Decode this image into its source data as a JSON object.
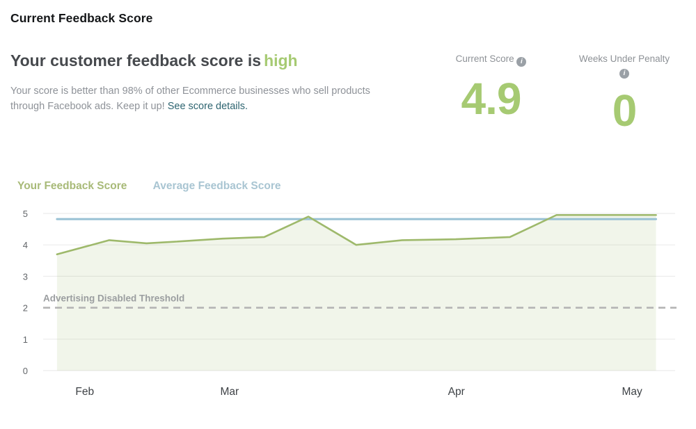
{
  "page": {
    "title": "Current Feedback Score"
  },
  "summary": {
    "heading_prefix": "Your customer feedback score is",
    "heading_status": "high",
    "body": "Your score is better than 98% of other Ecommerce businesses who sell products through Facebook ads. Keep it up!",
    "link_label": "See score details."
  },
  "stats": [
    {
      "label": "Current Score",
      "value": "4.9",
      "info_icon": "info-icon"
    },
    {
      "label": "Weeks Under Penalty",
      "value": "0",
      "info_icon": "info-icon"
    }
  ],
  "colors": {
    "accent_green": "#a6ca72",
    "line_green": "#9eb96b",
    "area_fill": "rgba(158,185,107,0.14)",
    "avg_blue": "#98c1d4",
    "legend_green": "#a8ba78",
    "legend_blue": "#a9c5d2",
    "link_teal": "#2d6470",
    "threshold_gray": "#b4b4b4",
    "grid_gray": "#ececec"
  },
  "chart_data": {
    "type": "line",
    "title": "",
    "xlabel": "",
    "ylabel": "",
    "ylim": [
      0,
      5
    ],
    "yticks": [
      0,
      1,
      2,
      3,
      4,
      5
    ],
    "grid": true,
    "legend_position": "top-left",
    "xticks": [
      {
        "label": "Feb",
        "x_pct": 6.6
      },
      {
        "label": "Mar",
        "x_pct": 29.6
      },
      {
        "label": "Apr",
        "x_pct": 65.6
      },
      {
        "label": "May",
        "x_pct": 93.5
      }
    ],
    "series": [
      {
        "name": "Your Feedback Score",
        "color": "#9eb96b",
        "fill": "rgba(158,185,107,0.14)",
        "points": [
          {
            "x_pct": 2.2,
            "y": 3.7
          },
          {
            "x_pct": 10.5,
            "y": 4.15
          },
          {
            "x_pct": 16.4,
            "y": 4.05
          },
          {
            "x_pct": 20.8,
            "y": 4.1
          },
          {
            "x_pct": 28.5,
            "y": 4.2
          },
          {
            "x_pct": 35.1,
            "y": 4.25
          },
          {
            "x_pct": 42.1,
            "y": 4.9
          },
          {
            "x_pct": 49.7,
            "y": 4.0
          },
          {
            "x_pct": 57.0,
            "y": 4.15
          },
          {
            "x_pct": 65.5,
            "y": 4.18
          },
          {
            "x_pct": 74.1,
            "y": 4.25
          },
          {
            "x_pct": 81.5,
            "y": 4.95
          },
          {
            "x_pct": 89.3,
            "y": 4.95
          },
          {
            "x_pct": 97.3,
            "y": 4.95
          }
        ]
      },
      {
        "name": "Average Feedback Score",
        "color": "#98c1d4",
        "points": [
          {
            "x_pct": 2.2,
            "y": 4.82
          },
          {
            "x_pct": 97.3,
            "y": 4.82
          }
        ]
      }
    ],
    "threshold": {
      "label": "Advertising Disabled Threshold",
      "y": 2
    }
  }
}
